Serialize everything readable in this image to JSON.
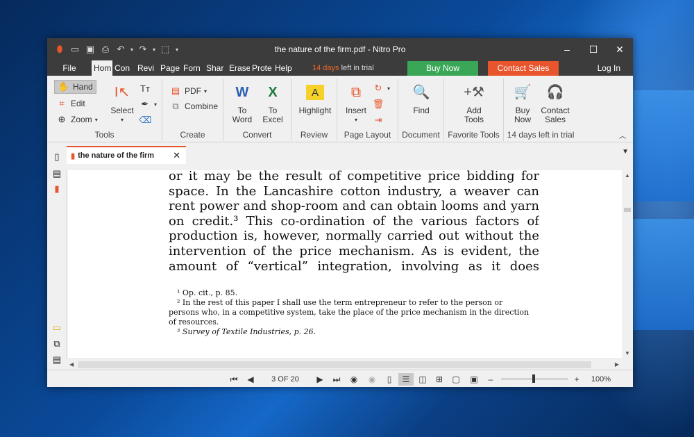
{
  "window": {
    "title": "the nature of the firm.pdf - Nitro Pro",
    "controls": {
      "minimize": "–",
      "maximize": "☐",
      "close": "✕"
    }
  },
  "quick_access": [
    {
      "name": "nitro-logo-icon",
      "glyph": "⬮"
    },
    {
      "name": "open-folder-icon",
      "glyph": "📂"
    },
    {
      "name": "save-icon",
      "glyph": "💾"
    },
    {
      "name": "print-icon",
      "glyph": "🖶"
    },
    {
      "name": "undo-icon",
      "glyph": "↶"
    },
    {
      "name": "redo-icon",
      "glyph": "↷"
    },
    {
      "name": "select-tool-icon",
      "glyph": "⬚"
    },
    {
      "name": "customize-icon",
      "glyph": "▾"
    }
  ],
  "menubar": {
    "file": "File",
    "tabs": [
      "Hom",
      "Con",
      "Revi",
      "Page",
      "Forn",
      "Shar",
      "Erase",
      "Prote",
      "Help"
    ],
    "trial_days": "14 days",
    "trial_text": "left in trial",
    "buy_now": "Buy Now",
    "contact_sales": "Contact Sales",
    "login": "Log In"
  },
  "ribbon": {
    "tools": {
      "hand": "Hand",
      "edit": "Edit",
      "zoom": "Zoom",
      "select": "Select",
      "label": "Tools"
    },
    "create": {
      "pdf": "PDF",
      "combine": "Combine",
      "label": "Create"
    },
    "convert": {
      "to_word": "To Word",
      "to_excel": "To Excel",
      "label": "Convert"
    },
    "review": {
      "highlight": "Highlight",
      "label": "Review"
    },
    "page_layout": {
      "insert": "Insert",
      "label": "Page Layout"
    },
    "document": {
      "find": "Find",
      "label": "Document"
    },
    "favorite": {
      "add_tools": "Add Tools",
      "label": "Favorite Tools"
    },
    "trial": {
      "buy_now": "Buy Now",
      "contact_sales": "Contact Sales",
      "label": "14 days left in trial"
    }
  },
  "document_tab": {
    "title": "the nature of the firm",
    "close": "✕"
  },
  "pdf": {
    "lines": [
      "or it may be the result of competitive price bidding for",
      "space. In the Lancashire cotton industry, a weaver can",
      "rent power and shop-room and can obtain looms and yarn",
      "on credit.³ This co-ordination of the various factors of",
      "production is, however, normally carried out without the",
      "intervention of the price mechanism. As is evident, the",
      "amount of “vertical” integration, involving as it does"
    ],
    "footnotes": [
      "¹ Op. cit., p. 85.",
      "² In the rest of this paper I shall use the term entrepreneur to refer to the person or",
      "persons who, in a competitive system, take the place of the price mechanism in the direction",
      "of resources.",
      "³ Survey of Textile Industries, p. 26."
    ]
  },
  "statusbar": {
    "page_info": "3 OF 20",
    "zoom_minus": "–",
    "zoom_plus": "+",
    "zoom": "100%"
  }
}
